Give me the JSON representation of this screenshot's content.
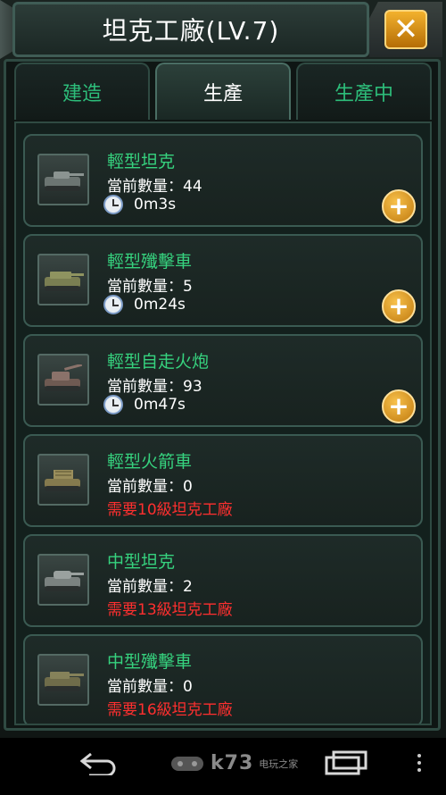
{
  "window": {
    "title": "坦克工廠(LV.7)",
    "close_icon": "close-icon"
  },
  "tabs": [
    {
      "label": "建造",
      "active": false
    },
    {
      "label": "生產",
      "active": true
    },
    {
      "label": "生產中",
      "active": false
    }
  ],
  "units": [
    {
      "name": "輕型坦克",
      "count_text": "當前數量：44",
      "time": "0m3s",
      "requirement": null,
      "can_produce": true
    },
    {
      "name": "輕型殲擊車",
      "count_text": "當前數量：5",
      "time": "0m24s",
      "requirement": null,
      "can_produce": true
    },
    {
      "name": "輕型自走火炮",
      "count_text": "當前數量：93",
      "time": "0m47s",
      "requirement": null,
      "can_produce": true
    },
    {
      "name": "輕型火箭車",
      "count_text": "當前數量：0",
      "time": null,
      "requirement": "需要10級坦克工廠",
      "can_produce": false
    },
    {
      "name": "中型坦克",
      "count_text": "當前數量：2",
      "time": null,
      "requirement": "需要13級坦克工廠",
      "can_produce": false
    },
    {
      "name": "中型殲擊車",
      "count_text": "當前數量：0",
      "time": null,
      "requirement": "需要16級坦克工廠",
      "can_produce": false
    }
  ],
  "navbar": {
    "back_icon": "back-icon",
    "home_icon": "home-icon",
    "recents_icon": "recents-icon",
    "menu_icon": "menu-icon",
    "watermark_logo": "k73",
    "watermark_text": "电玩之家"
  },
  "colors": {
    "unit_name": "#36d27e",
    "requirement": "#ff2f2f",
    "tab_inactive": "#2dbd7a",
    "accent_gold": "#f2b12d"
  }
}
